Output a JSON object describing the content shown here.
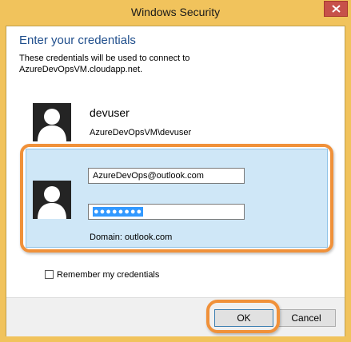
{
  "window": {
    "title": "Windows Security"
  },
  "header": {
    "heading": "Enter your credentials",
    "line1": "These credentials will be used to connect to",
    "line2": "AzureDevOpsVM.cloudapp.net."
  },
  "saved_user": {
    "name": "devuser",
    "account": "AzureDevOpsVM\\devuser"
  },
  "new_credential": {
    "username_value": "AzureDevOps@outlook.com",
    "password_mask": "●●●●●●●●",
    "domain": "Domain: outlook.com"
  },
  "options": {
    "remember_label": "Remember my credentials"
  },
  "buttons": {
    "ok": "OK",
    "cancel": "Cancel"
  },
  "colors": {
    "title_bar": "#f1c35c",
    "heading": "#1f4e8c",
    "tile_selected": "#cfe7f7",
    "annotation": "#f0913a",
    "close_button": "#c7514a"
  },
  "icons": {
    "close": "close-icon",
    "avatar": "user-avatar-icon"
  }
}
